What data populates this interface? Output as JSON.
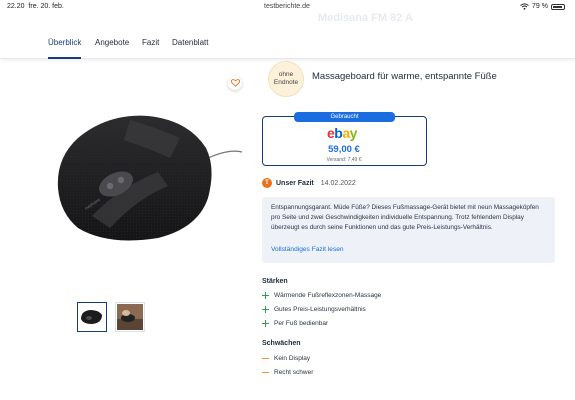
{
  "status_bar": {
    "time": "22.20",
    "date": "fre. 20. feb.",
    "url": "testberichte.de",
    "battery": "79 %"
  },
  "background_title": "Medisana FM 82 A",
  "nav": {
    "tabs": [
      "Überblick",
      "Angebote",
      "Fazit",
      "Datenblatt"
    ],
    "active": "Überblick"
  },
  "product": {
    "brand_on_device": "medisana",
    "image_alt": "Massageboard"
  },
  "rating_badge": {
    "line1": "ohne",
    "line2": "Endnote"
  },
  "headline": "Massageboard für warme, entspannte Füße",
  "offer": {
    "condition": "Gebraucht",
    "shop": "ebay",
    "price": "59,00 €",
    "shipping": "Versand: 7,49 €"
  },
  "fazit": {
    "icon_letter": "T",
    "label": "Unser Fazit",
    "date": "14.02.2022",
    "text": "Entspannungsgarant. Müde Füße? Dieses Fußmassage-Gerät bietet mit neun Massageköpfen pro Seite und zwei Geschwindigkeiten individuelle Entspannung. Trotz fehlendem Display überzeugt es durch seine Funktionen und das gute Preis-Leistungs-Verhältnis.",
    "link": "Vollständiges Fazit lesen"
  },
  "strengths": {
    "title": "Stärken",
    "items": [
      "Wärmende Fußreflexzonen-Massage",
      "Gutes Preis-Leistungsverhältnis",
      "Per Fuß bedienbar"
    ]
  },
  "weaknesses": {
    "title": "Schwächen",
    "items": [
      "Kein Display",
      "Recht schwer"
    ]
  },
  "colors": {
    "accent": "#1a3b7a",
    "link": "#1a6de0",
    "positive": "#2e9d5a",
    "negative": "#e69a2e",
    "fazit_bg": "#eef2f8"
  }
}
